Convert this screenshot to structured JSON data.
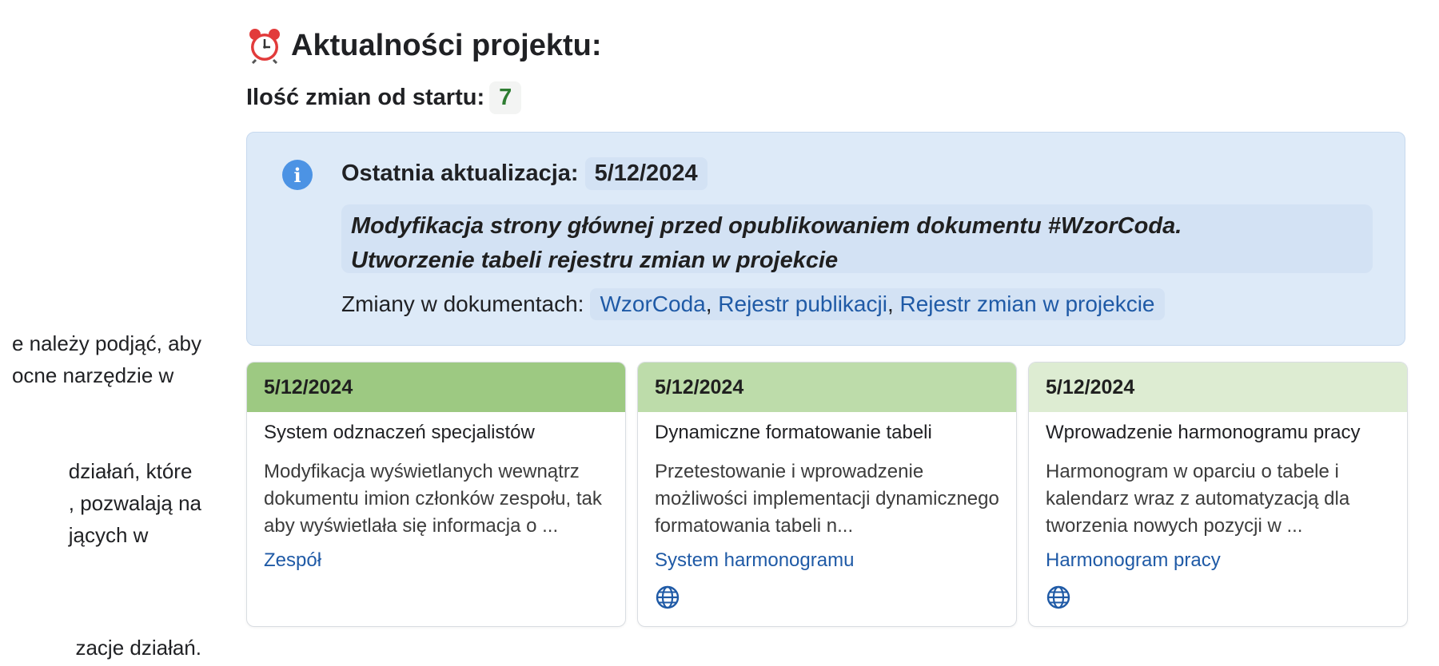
{
  "left_column": {
    "para1": [
      "e należy podjąć, aby",
      "ocne narzędzie w"
    ],
    "para2": [
      "działań, które",
      ", pozwalają na",
      "jących w"
    ],
    "para3": [
      "zacje działań."
    ]
  },
  "header": {
    "title": "Aktualności projektu:",
    "count_label": "Ilość zmian od startu:",
    "count_value": "7"
  },
  "latest_update": {
    "label": "Ostatnia aktualizacja:",
    "date": "5/12/2024",
    "description": "Modyfikacja strony głównej przed opublikowaniem dokumentu #WzorCoda.\nUtworzenie tabeli rejestru zmian w projekcie",
    "docs_label": "Zmiany w dokumentach:",
    "docs": [
      "WzorCoda",
      "Rejestr publikacji",
      "Rejestr zmian w projekcie"
    ]
  },
  "cards": [
    {
      "date": "5/12/2024",
      "title": "System odznaczeń specjalistów",
      "description": "Modyfikacja wyświetlanych wewnątrz dokumentu imion członków zespołu, tak aby wyświetlała się informacja o ...",
      "link": "Zespół",
      "has_globe": false,
      "header_color": "#9dc982"
    },
    {
      "date": "5/12/2024",
      "title": "Dynamiczne formatowanie tabeli",
      "description": "Przetestowanie i wprowadzenie możliwości implementacji dynamicznego formatowania tabeli n...",
      "link": "System harmonogramu",
      "has_globe": true,
      "header_color": "#bddcaa"
    },
    {
      "date": "5/12/2024",
      "title": "Wprowadzenie harmonogramu pracy",
      "description": "Harmonogram w oparciu o tabele i kalendarz wraz z automatyzacją dla tworzenia nowych pozycji w ...",
      "link": "Harmonogram pracy",
      "has_globe": true,
      "header_color": "#ddecd2"
    }
  ],
  "icons": {
    "title_icon": "alarm-clock-icon",
    "info_icon": "info-icon",
    "card_icon": "globe-icon"
  }
}
